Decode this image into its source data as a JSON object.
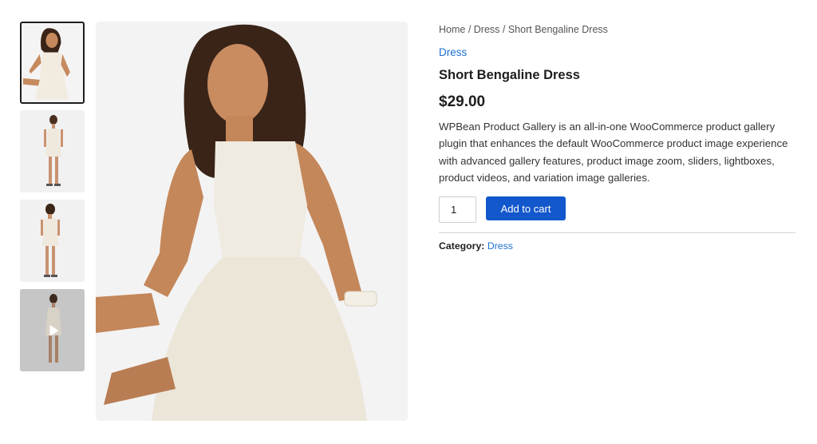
{
  "gallery": {
    "thumbnails": [
      {
        "label": "product image 1",
        "active": true
      },
      {
        "label": "product image 2",
        "active": false
      },
      {
        "label": "product image 3",
        "active": false
      },
      {
        "label": "product video",
        "active": false,
        "icon": "play-icon"
      }
    ],
    "main_image": {
      "label": "model in cream sleeveless dress"
    }
  },
  "breadcrumb": {
    "home": "Home",
    "sep1": " / ",
    "category": "Dress",
    "sep2": " / ",
    "current": "Short Bengaline Dress"
  },
  "product": {
    "category_link": "Dress",
    "title": "Short Bengaline Dress",
    "price": "$29.00",
    "description": "WPBean Product Gallery is an all-in-one WooCommerce product gallery plugin that enhances the default WooCommerce product image experience with advanced gallery features, product image zoom, sliders, lightboxes, product videos, and variation image galleries.",
    "quantity": "1",
    "add_to_cart_label": "Add to cart"
  },
  "meta": {
    "category_key": "Category:",
    "category_value": "Dress"
  },
  "colors": {
    "accent": "#1257cc",
    "link": "#1f6fd1"
  }
}
